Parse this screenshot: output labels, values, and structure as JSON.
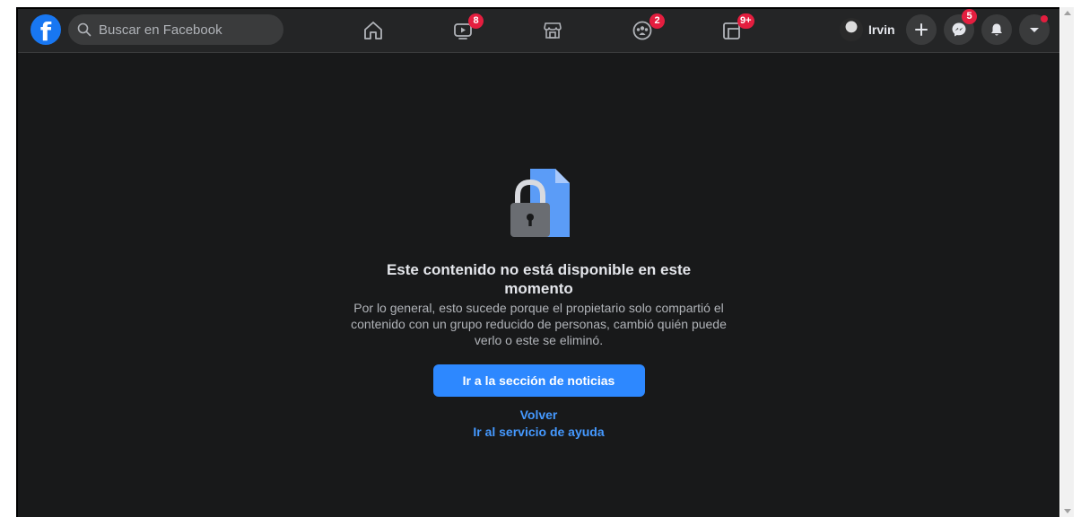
{
  "header": {
    "search": {
      "placeholder": "Buscar en Facebook"
    },
    "nav": [
      {
        "name": "home",
        "icon": "home-icon",
        "badge": ""
      },
      {
        "name": "watch",
        "icon": "video-icon",
        "badge": "8"
      },
      {
        "name": "marketplace",
        "icon": "store-icon",
        "badge": ""
      },
      {
        "name": "groups",
        "icon": "groups-icon",
        "badge": "2"
      },
      {
        "name": "gaming",
        "icon": "gaming-icon",
        "badge": "9+"
      }
    ],
    "profile": {
      "name": "Irvin"
    },
    "messenger_badge": "5",
    "colors": {
      "bar": "#242526",
      "accent": "#1877f2",
      "badge": "#e41e3f"
    }
  },
  "main": {
    "title": "Este contenido no está disponible en este momento",
    "description": "Por lo general, esto sucede porque el propietario solo compartió el contenido con un grupo reducido de personas, cambió quién puede verlo o este se eliminó.",
    "primary_button": "Ir a la sección de noticias",
    "back_link": "Volver",
    "help_link": "Ir al servicio de ayuda"
  }
}
